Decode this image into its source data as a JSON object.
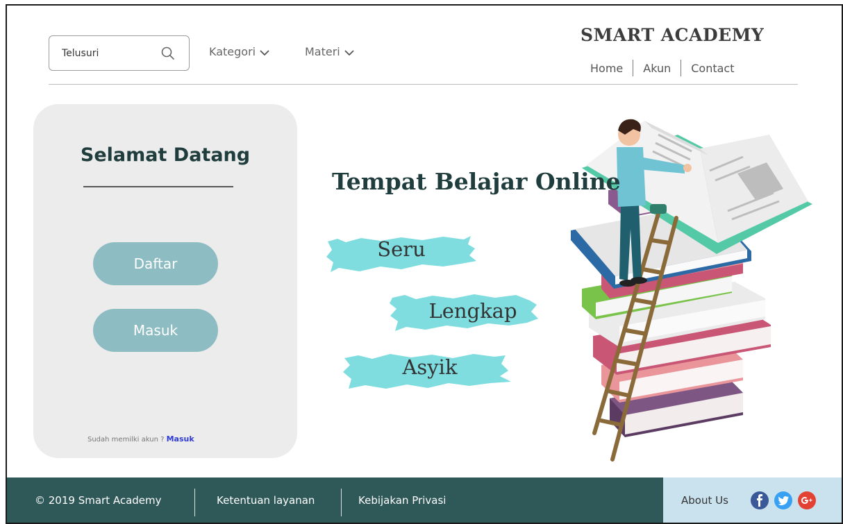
{
  "header": {
    "search_placeholder": "Telusuri",
    "nav_dropdowns": [
      "Kategori",
      "Materi"
    ],
    "brand": "SMART ACADEMY",
    "links": [
      "Home",
      "Akun",
      "Contact"
    ]
  },
  "sidebar": {
    "title": "Selamat Datang",
    "register_label": "Daftar",
    "login_label": "Masuk",
    "hint": "Sudah memilki akun ?",
    "hint_link": "Masuk"
  },
  "hero": {
    "title": "Tempat Belajar Online",
    "tags": [
      "Seru",
      "Lengkap",
      "Asyik"
    ]
  },
  "footer": {
    "copyright": "© 2019 Smart Academy",
    "terms": "Ketentuan layanan",
    "privacy": "Kebijakan Privasi",
    "about": "About Us",
    "social": [
      "facebook-icon",
      "twitter-icon",
      "google-plus-icon"
    ]
  },
  "colors": {
    "footer_bg": "#2f5858",
    "footer_right_bg": "#c9e2ee",
    "button_bg": "#8dbdc2",
    "brush": "#7fdde0",
    "title_color": "#1f3d3c",
    "link_color": "#2e3bd6"
  }
}
